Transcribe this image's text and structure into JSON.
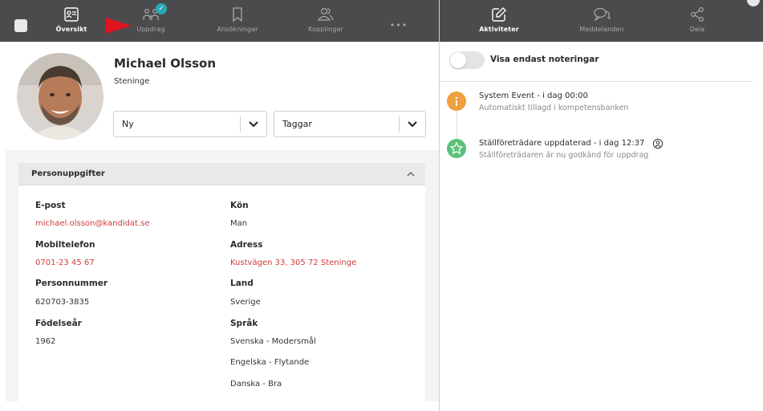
{
  "nav_left": {
    "items": [
      {
        "label": "Översikt",
        "icon": "id-card-icon",
        "active": true
      },
      {
        "label": "Uppdrag",
        "icon": "people-link-icon",
        "badge": "✓"
      },
      {
        "label": "Ansökningar",
        "icon": "bookmark-icon"
      },
      {
        "label": "Kopplingar",
        "icon": "users-icon"
      },
      {
        "label": "•••",
        "icon": "more-icon"
      }
    ]
  },
  "nav_right": {
    "items": [
      {
        "label": "Aktiviteter",
        "icon": "edit-icon",
        "active": true
      },
      {
        "label": "Meddelanden",
        "icon": "chat-icon"
      },
      {
        "label": "Dela",
        "icon": "share-icon"
      }
    ]
  },
  "profile": {
    "name": "Michael Olsson",
    "location": "Steninge",
    "status_select": "Ny",
    "tags_select": "Taggar"
  },
  "personal": {
    "section_title": "Personuppgifter",
    "fields_left": [
      {
        "label": "E-post",
        "value": "michael.olsson@kandidat.se",
        "link": true
      },
      {
        "label": "Mobiltelefon",
        "value": "0701-23 45 67",
        "link": true
      },
      {
        "label": "Personnummer",
        "value": "620703-3835"
      },
      {
        "label": "Födelseår",
        "value": "1962"
      }
    ],
    "fields_right": [
      {
        "label": "Kön",
        "value": "Man"
      },
      {
        "label": "Adress",
        "value": "Kustvägen 33, 305 72 Steninge",
        "link": true
      },
      {
        "label": "Land",
        "value": "Sverige"
      },
      {
        "label": "Språk",
        "values": [
          "Svenska - Modersmål",
          "Engelska - Flytande",
          "Danska - Bra"
        ]
      }
    ]
  },
  "activity": {
    "toggle_label": "Visa endast noteringar",
    "toggle_on": false,
    "events": [
      {
        "title": "System Event - i dag 00:00",
        "subtitle": "Automatiskt tillagd i kompetensbanken",
        "color": "#f0a03c",
        "icon": "info-icon"
      },
      {
        "title": "Ställföreträdare uppdaterad - i dag 12:37",
        "subtitle": "Ställföreträdaren är nu godkänd för uppdrag",
        "color": "#5cc17a",
        "icon": "star-icon"
      }
    ]
  },
  "colors": {
    "nav_bg": "#4b4b4d",
    "link": "#d23b3b",
    "badge": "#2ba7b6"
  }
}
